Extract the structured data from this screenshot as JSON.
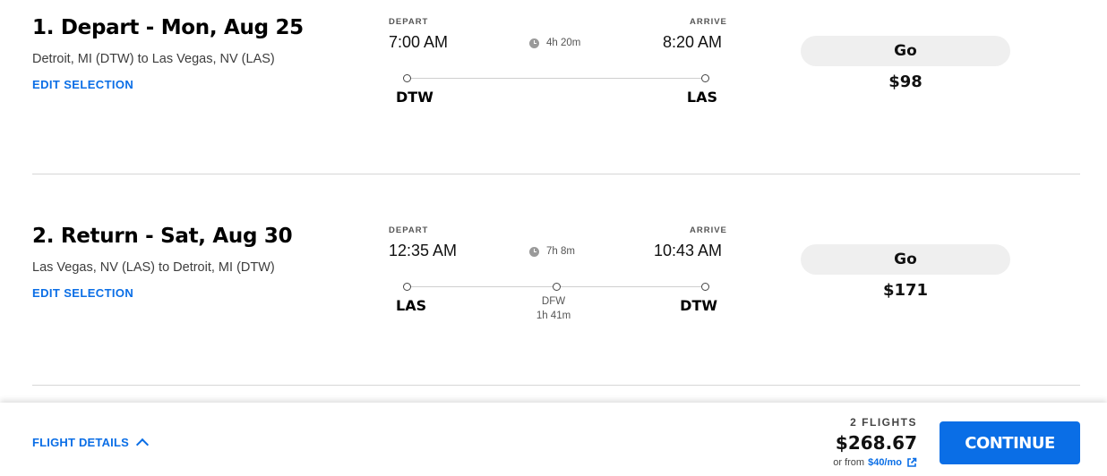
{
  "flights": [
    {
      "title": "1. Depart - Mon, Aug 25",
      "route": "Detroit, MI (DTW) to Las Vegas, NV (LAS)",
      "edit_label": "EDIT SELECTION",
      "depart_label": "DEPART",
      "arrive_label": "ARRIVE",
      "depart_time": "7:00 AM",
      "arrive_time": "8:20 AM",
      "duration": "4h 20m",
      "origin": "DTW",
      "destination": "LAS",
      "fare_class": "Go",
      "price": "$98"
    },
    {
      "title": "2. Return - Sat, Aug 30",
      "route": "Las Vegas, NV (LAS) to Detroit, MI (DTW)",
      "edit_label": "EDIT SELECTION",
      "depart_label": "DEPART",
      "arrive_label": "ARRIVE",
      "depart_time": "12:35 AM",
      "arrive_time": "10:43 AM",
      "duration": "7h 8m",
      "origin": "LAS",
      "destination": "DTW",
      "stop": {
        "code": "DFW",
        "layover": "1h 41m"
      },
      "fare_class": "Go",
      "price": "$171"
    }
  ],
  "footer": {
    "details_label": "FLIGHT DETAILS",
    "flights_count": "2 FLIGHTS",
    "total_price": "$268.67",
    "financing_prefix": "or from",
    "financing_amount": "$40/mo",
    "continue_label": "CONTINUE"
  },
  "colors": {
    "accent": "#0a6ee6",
    "fare_pill_bg": "#efefef",
    "divider": "#d6d6d6"
  },
  "icons": [
    "clock-icon",
    "chevron-up-icon",
    "external-link-icon"
  ]
}
